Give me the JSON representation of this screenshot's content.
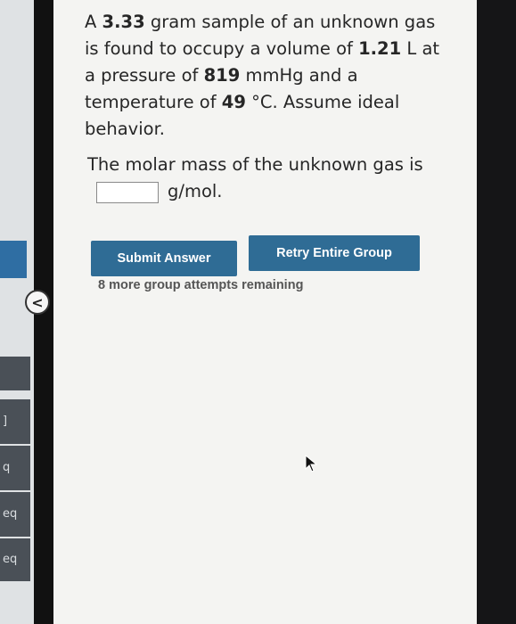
{
  "question": {
    "part1": "A ",
    "mass": "3.33",
    "part2": " gram sample of an unknown gas is found to occupy a volume of ",
    "volume": "1.21",
    "part3": " L at a pressure of ",
    "pressure": "819",
    "part4": " mmHg and a temperature of ",
    "temperature": "49",
    "part5": " °C. Assume ideal behavior."
  },
  "answer": {
    "prefix": "The molar mass of the unknown gas is",
    "unit": "g/mol.",
    "value": ""
  },
  "buttons": {
    "submit_label": "Submit Answer",
    "retry_label": "Retry Entire Group"
  },
  "attempts_text": "8 more group attempts remaining",
  "sidebar": {
    "collapse_glyph": "<",
    "tabs": [
      "]",
      "q",
      "eq",
      "eq"
    ]
  },
  "colors": {
    "button": "#2f6c95",
    "page_bg": "#f4f4f2"
  }
}
